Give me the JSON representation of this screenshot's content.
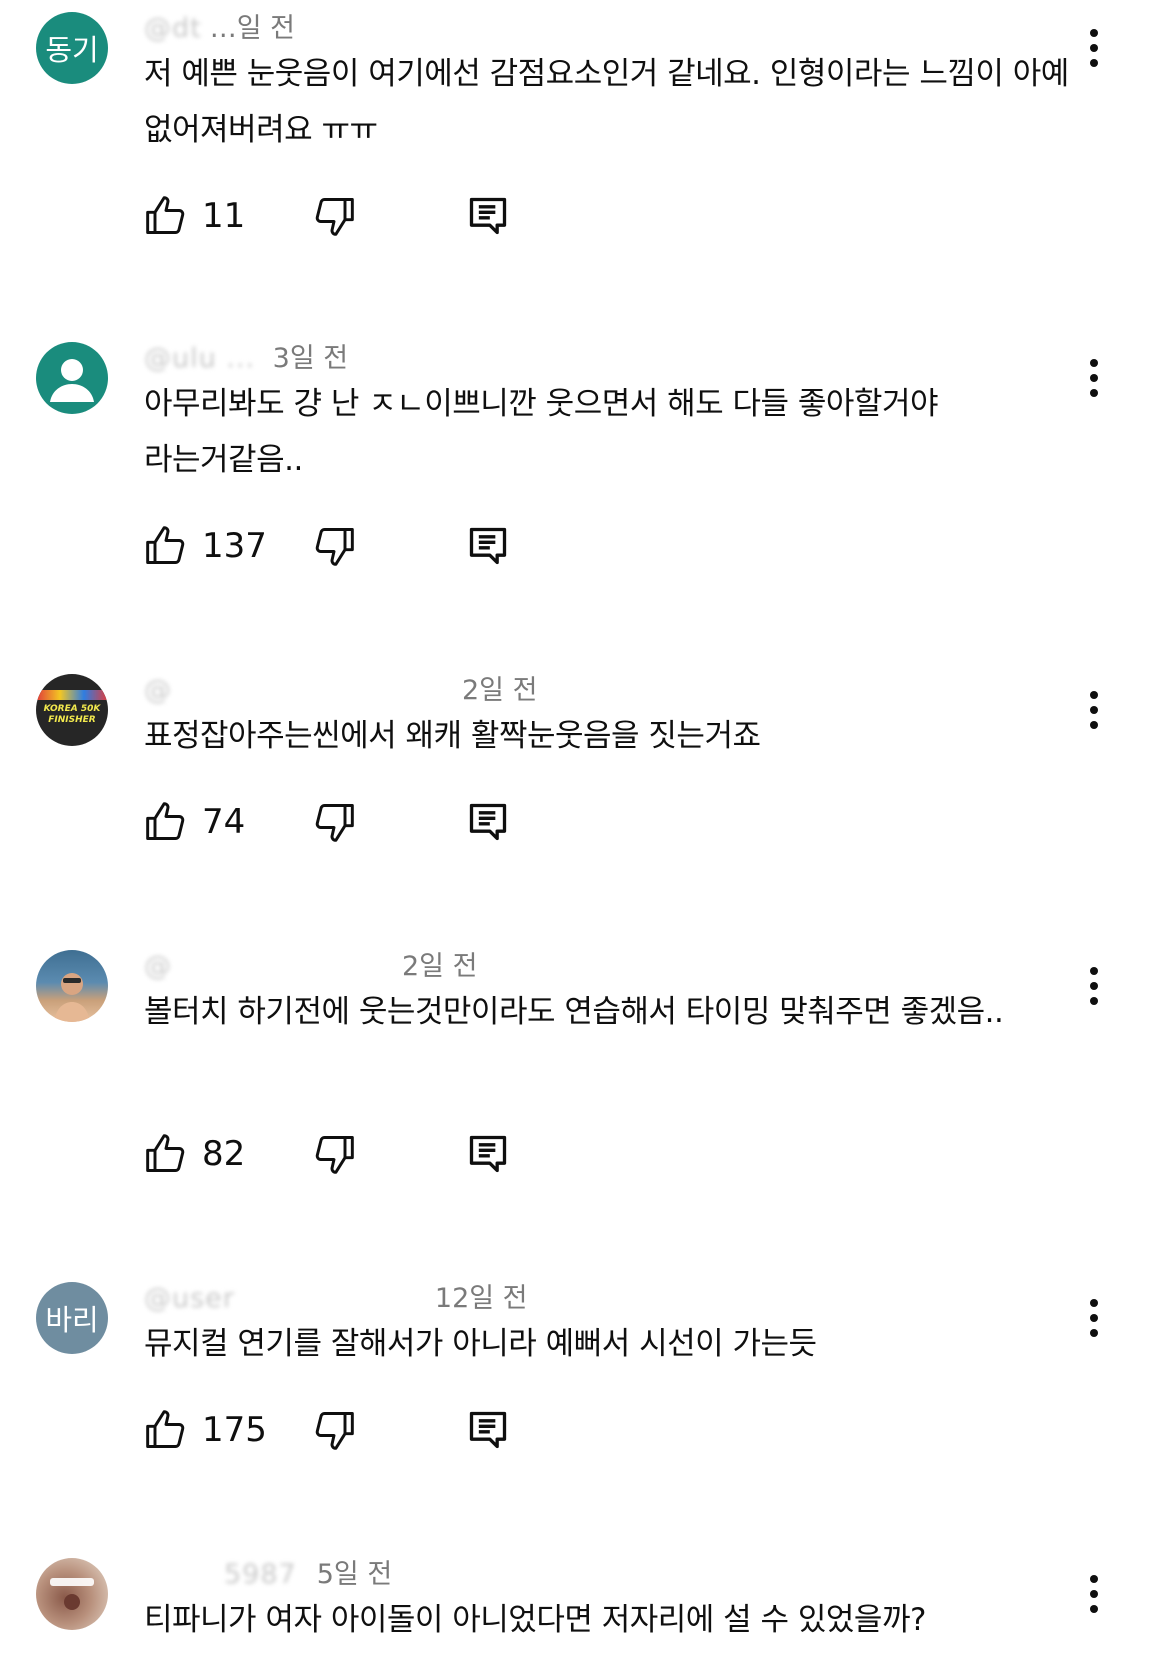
{
  "comments": [
    {
      "avatar_text": "동기",
      "avatar_color": "#1a8c7d",
      "handle": "@dt",
      "time": "…일 전",
      "text": "저 예쁜 눈웃음이 여기에선 감점요소인거 같네요. 인형이라는 느낌이 아예 없어져버려요 ㅠㅠ",
      "likes": "11"
    },
    {
      "avatar_text": "",
      "avatar_color": "#1a8c7d",
      "handle": "@ulu ... ",
      "time": "3일 전",
      "text": "아무리봐도 걍 난 ㅈㄴ이쁘니깐 웃으면서 해도 다들 좋아할거야 라는거같음..",
      "likes": "137"
    },
    {
      "avatar_text": "KOREA 50K FINISHER",
      "avatar_color": "#262626",
      "handle": "@",
      "time": "2일 전",
      "text": "표정잡아주는씬에서 왜캐 활짝눈웃음을 짓는거죠",
      "likes": "74"
    },
    {
      "avatar_text": "",
      "avatar_color": "#4a7a9a",
      "handle": "@",
      "time": "2일 전",
      "text": "볼터치 하기전에 웃는것만이라도 연습해서 타이밍 맞춰주면 좋겠음..",
      "likes": "82"
    },
    {
      "avatar_text": "바리",
      "avatar_color": "#6f8da0",
      "handle": "@user",
      "time": "12일 전",
      "text": "뮤지컬 연기를 잘해서가 아니라 예뻐서 시선이 가는듯",
      "likes": "175"
    },
    {
      "avatar_text": "",
      "avatar_color": "#a37a6a",
      "handle": "5987",
      "time": "5일 전",
      "text": "티파니가 여자 아이돌이 아니었다면 저자리에 설 수 있었을까?",
      "likes": ""
    }
  ],
  "icons": {
    "like": "thumbs-up-icon",
    "dislike": "thumbs-down-icon",
    "reply": "reply-icon",
    "more": "more-vert-icon"
  }
}
